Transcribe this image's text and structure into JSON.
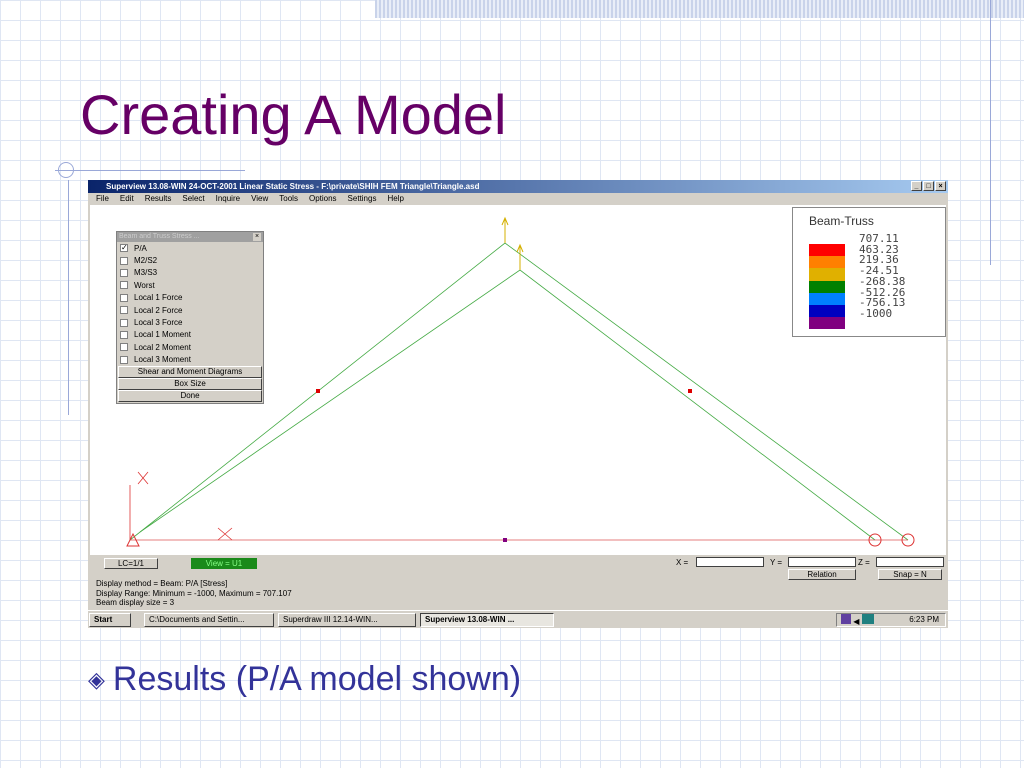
{
  "slide": {
    "title": "Creating A Model",
    "bullet": "Results (P/A model shown)",
    "bullet_icon": "diamond-bullet-icon"
  },
  "window": {
    "title": "Superview 13.08-WIN 24-OCT-2001 Linear Static Stress - F:\\private\\SHIH FEM Triangle\\Triangle.asd",
    "menu": [
      "File",
      "Edit",
      "Results",
      "Select",
      "Inquire",
      "View",
      "Tools",
      "Options",
      "Settings",
      "Help"
    ]
  },
  "panel": {
    "title": "Beam and Truss Stress ...",
    "options": [
      {
        "label": "P/A",
        "checked": true
      },
      {
        "label": "M2/S2",
        "checked": false
      },
      {
        "label": "M3/S3",
        "checked": false
      },
      {
        "label": "Worst",
        "checked": false
      },
      {
        "label": "Local 1 Force",
        "checked": false
      },
      {
        "label": "Local 2 Force",
        "checked": false
      },
      {
        "label": "Local 3 Force",
        "checked": false
      },
      {
        "label": "Local 1 Moment",
        "checked": false
      },
      {
        "label": "Local 2 Moment",
        "checked": false
      },
      {
        "label": "Local 3 Moment",
        "checked": false
      }
    ],
    "buttons": [
      "Shear and Moment Diagrams",
      "Box Size",
      "Done"
    ]
  },
  "legend": {
    "title": "Beam-Truss",
    "values": [
      "707.11",
      "463.23",
      "219.36",
      "-24.51",
      "-268.38",
      "-512.26",
      "-756.13",
      "-1000"
    ],
    "colors": [
      "#ff0000",
      "#ff8000",
      "#e0b000",
      "#008000",
      "#0080ff",
      "#0000c0",
      "#800080"
    ]
  },
  "status": {
    "lc": "LC=1/1",
    "view": "View = U1",
    "x_label": "X =",
    "y_label": "Y =",
    "z_label": "Z =",
    "relation": "Relation",
    "snap": "Snap = N",
    "lines": [
      "Display method = Beam: P/A  [Stress]",
      "Display Range: Minimum = -1000, Maximum = 707.107",
      "Beam display size = 3"
    ]
  },
  "taskbar": {
    "start": "Start",
    "items": [
      "C:\\Documents and Settin...",
      "Superdraw III 12.14-WIN...",
      "Superview 13.08-WIN ..."
    ],
    "clock": "6:23 PM"
  }
}
